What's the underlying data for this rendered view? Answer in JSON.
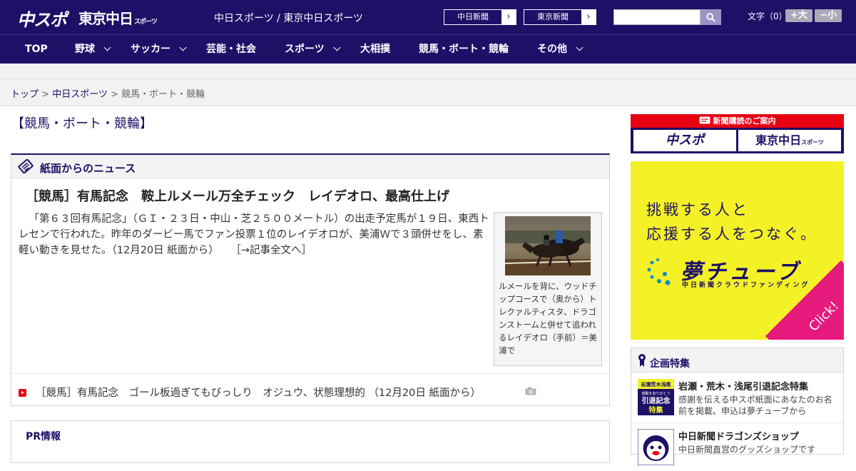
{
  "header": {
    "logo_chuspo": "中スポ",
    "logo_tokyo": "東京中日",
    "logo_tokyo_sub": "スポーツ",
    "site_links": "中日スポーツ / 東京中日スポーツ",
    "paper_buttons": [
      "中日新聞",
      "東京新聞"
    ],
    "search_placeholder": "",
    "font_size_label": "文字（0）",
    "font_bigger": "+大",
    "font_smaller": "−小"
  },
  "nav": {
    "items": [
      {
        "label": "TOP"
      },
      {
        "label": "野球"
      },
      {
        "label": "サッカー"
      },
      {
        "label": "芸能・社会"
      },
      {
        "label": "スポーツ"
      },
      {
        "label": "大相撲"
      },
      {
        "label": "競馬・ボート・競輪"
      },
      {
        "label": "その他"
      }
    ]
  },
  "breadcrumb": {
    "top": "トップ",
    "sep1": " > ",
    "section": "中日スポーツ",
    "sep2": " > ",
    "current": "競馬・ボート・競輪"
  },
  "page_title": "【競馬・ボート・競輪】",
  "news": {
    "section_title": "紙面からのニュース",
    "headline": "［競馬］有馬記念　鞍上ルメール万全チェック　レイデオロ、最高仕上げ",
    "body": "「第６３回有馬記念」（ＧＩ・２３日・中山・芝２５００メートル）の出走予定馬が１９日、東西トレセンで行われた。昨年のダービー馬でファン投票１位のレイデオロが、美浦Ｗで３頭併せをし、素軽い動きを見せた。（12月20日 紙面から）",
    "more_link": "［→記事全文へ］",
    "photo_caption": "ルメールを背に、ウッドチップコースで（奥から）トレクァルティスタ、ドラゴンストームと併せて追われるレイデオロ（手前）＝美浦で",
    "related": "［競馬］有馬記念　ゴール板過ぎてもびっしり　オジュウ、状態理想的 （12月20日 紙面から）"
  },
  "pr": {
    "title": "PR情報"
  },
  "sidebar": {
    "subscription_head": "新聞購読のご案内",
    "sub_logo_1": "中スポ",
    "sub_logo_2": "東京中日",
    "sub_logo_2_small": "スポーツ",
    "banner": {
      "line1": "挑戦する人と",
      "line2": "応援する人をつなぐ。",
      "brand": "夢チューブ",
      "brand_sub": "中日新聞クラウドファンディング",
      "click": "Click!"
    },
    "features_title": "企画特集",
    "features": [
      {
        "name": "岩瀬・荒木・浅尾引退記念特集",
        "desc": "感謝を伝える中スポ紙面にあなたのお名前を掲載、申込は夢チューブから",
        "thumb_text": "岩瀬荒木浅尾 感動をありがとう 引退記念特集"
      },
      {
        "name": "中日新聞ドラゴンズショップ",
        "desc": "中日新聞直営のグッズショップです"
      }
    ]
  },
  "colors": {
    "brand_navy": "#1d1067",
    "accent_red": "#e60012",
    "banner_yellow": "#f4f127",
    "banner_pink": "#e6197d"
  }
}
